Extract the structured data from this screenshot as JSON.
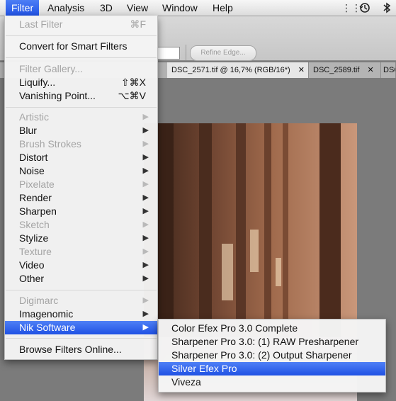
{
  "menubar": {
    "items": [
      "Filter",
      "Analysis",
      "3D",
      "View",
      "Window",
      "Help"
    ],
    "icons": [
      "grid-icon",
      "time-machine-icon",
      "bluetooth-icon"
    ]
  },
  "options_bar": {
    "refine_edge": "Refine Edge..."
  },
  "tabs": [
    {
      "label": "DSC_2571.tif @ 16,7% (RGB/16*)",
      "close": "✕"
    },
    {
      "label": "DSC_2589.tif",
      "close": "✕"
    },
    {
      "label": "DSC"
    }
  ],
  "filter_menu": {
    "last_filter": {
      "label": "Last Filter",
      "shortcut": "⌘F"
    },
    "convert": "Convert for Smart Filters",
    "filter_gallery": "Filter Gallery...",
    "liquify": {
      "label": "Liquify...",
      "shortcut": "⇧⌘X"
    },
    "vanishing": {
      "label": "Vanishing Point...",
      "shortcut": "⌥⌘V"
    },
    "group1": [
      "Artistic",
      "Blur",
      "Brush Strokes",
      "Distort",
      "Noise",
      "Pixelate",
      "Render",
      "Sharpen",
      "Sketch",
      "Stylize",
      "Texture",
      "Video",
      "Other"
    ],
    "group2": [
      "Digimarc",
      "Imagenomic",
      "Nik Software"
    ],
    "browse": "Browse Filters Online..."
  },
  "submenu": {
    "items": [
      "Color Efex Pro 3.0 Complete",
      "Sharpener Pro 3.0: (1) RAW Presharpener",
      "Sharpener Pro 3.0: (2) Output Sharpener",
      "Silver Efex Pro",
      "Viveza"
    ],
    "selected": "Silver Efex Pro"
  },
  "colors": {
    "highlight": "#2456e6",
    "disabled_text": "#a4a4a4"
  }
}
